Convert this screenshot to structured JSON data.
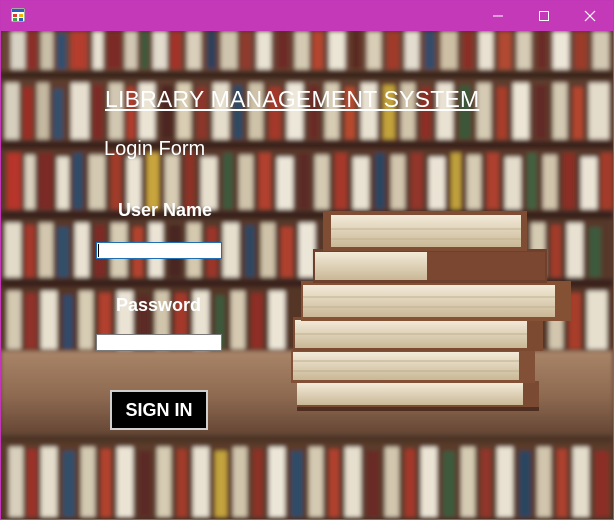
{
  "window": {
    "minimize_glyph": "—",
    "maximize_glyph": "☐",
    "close_glyph": "✕",
    "titlebar_color": "#c339b8"
  },
  "header": {
    "title": "LIBRARY  MANAGEMENT SYSTEM",
    "subtitle": "Login Form"
  },
  "form": {
    "username_label": "User Name",
    "username_value": "",
    "password_label": "Password",
    "password_value": "",
    "submit_label": "SIGN IN"
  }
}
